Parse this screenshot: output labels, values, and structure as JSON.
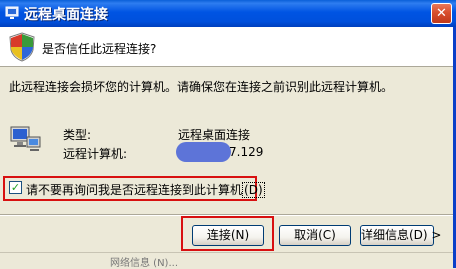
{
  "window": {
    "title": "远程桌面连接",
    "close_label": "✕"
  },
  "header": {
    "question": "是否信任此远程连接?"
  },
  "warning": "此远程连接会损坏您的计算机。请确保您在连接之前识别此远程计算机。",
  "details": {
    "type_label": "类型:",
    "type_value": "远程桌面连接",
    "computer_label": "远程计算机:",
    "computer_value_visible": "7.129"
  },
  "checkbox": {
    "label": "请不要再询问我是否远程连接到此计算机",
    "accel": "(D)",
    "checked": true
  },
  "buttons": {
    "connect": "连接(N)",
    "cancel": "取消(C)",
    "details": "详细信息(D) >"
  },
  "statusbar": {
    "fragment": "网络信息 (N)..."
  },
  "colors": {
    "title_bar": "#0054e3",
    "highlight": "#d81010",
    "blur": "#5d74d8"
  }
}
